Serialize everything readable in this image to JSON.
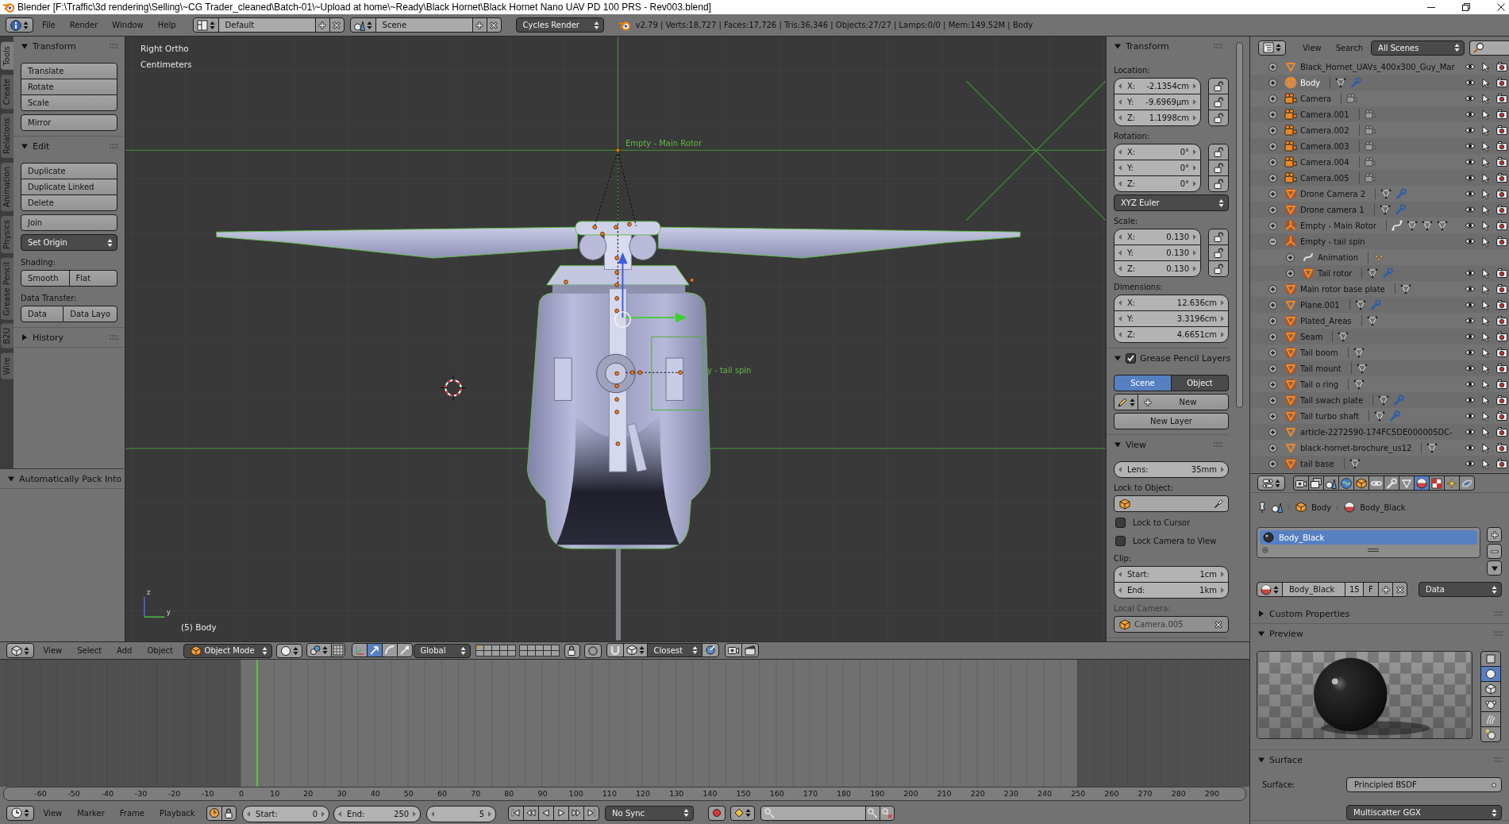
{
  "window": {
    "title": "Blender [F:\\Traffic\\3d rendering\\Selling\\~CG Trader_cleaned\\Batch-01\\~Upload at home\\~Ready\\Black Hornet\\Black Hornet Nano UAV PD 100 PRS - Rev003.blend]"
  },
  "info_header": {
    "menus": [
      "File",
      "Render",
      "Window",
      "Help"
    ],
    "screen_layout": "Default",
    "scene": "Scene",
    "render_engine": "Cycles Render",
    "stats": "v2.79 | Verts:18,727 | Faces:17,726 | Tris:36,346 | Objects:27/27 | Lamps:0/0 | Mem:149.52M | Body"
  },
  "tool_tabs": [
    {
      "label": "Tools",
      "selected": true
    },
    {
      "label": "Create",
      "selected": false
    },
    {
      "label": "Relations",
      "selected": false
    },
    {
      "label": "Animation",
      "selected": false
    },
    {
      "label": "Physics",
      "selected": false
    },
    {
      "label": "Grease Pencil",
      "selected": false
    },
    {
      "label": "B2U",
      "selected": false
    },
    {
      "label": "Wire",
      "selected": false
    }
  ],
  "tool_shelf": {
    "panels": [
      {
        "title": "Transform",
        "expanded": true,
        "rows": [
          {
            "kind": "column",
            "items": [
              "Translate",
              "Rotate",
              "Scale"
            ]
          },
          {
            "kind": "column",
            "items": [
              "Mirror"
            ]
          }
        ]
      },
      {
        "title": "Edit",
        "expanded": true,
        "rows": [
          {
            "kind": "column",
            "items": [
              "Duplicate",
              "Duplicate Linked",
              "Delete"
            ]
          },
          {
            "kind": "column",
            "items": [
              "Join"
            ]
          },
          {
            "kind": "menu",
            "label": "Set Origin"
          },
          {
            "kind": "label",
            "text": "Shading:"
          },
          {
            "kind": "row",
            "items": [
              "Smooth",
              "Flat"
            ]
          },
          {
            "kind": "label",
            "text": "Data Transfer:"
          },
          {
            "kind": "row",
            "items": [
              "Data",
              "Data Layo"
            ]
          }
        ]
      },
      {
        "title": "History",
        "expanded": false
      }
    ],
    "operator_panel": {
      "title": "Automatically Pack Into",
      "expanded": true
    }
  },
  "viewport": {
    "view_name": "Right Ortho",
    "units": "Centimeters",
    "object_info": "(5) Body",
    "object_labels": [
      "Empty - Main Rotor",
      "y - tail spin"
    ],
    "axis_labels": [
      "z",
      "y"
    ]
  },
  "properties_region": {
    "panels": [
      {
        "title": "Transform",
        "expanded": true,
        "rows": [
          {
            "kind": "label",
            "text": "Location:"
          },
          {
            "kind": "vector",
            "fields": [
              {
                "label": "X:",
                "value": "-2.1354cm",
                "locked": false
              },
              {
                "label": "Y:",
                "value": "-9.6969µm",
                "locked": false
              },
              {
                "label": "Z:",
                "value": "1.1998cm",
                "locked": false
              }
            ]
          },
          {
            "kind": "label",
            "text": "Rotation:"
          },
          {
            "kind": "vector",
            "fields": [
              {
                "label": "X:",
                "value": "0°",
                "locked": false
              },
              {
                "label": "Y:",
                "value": "0°",
                "locked": false
              },
              {
                "label": "Z:",
                "value": "0°",
                "locked": false
              }
            ]
          },
          {
            "kind": "menu",
            "label": "XYZ Euler"
          },
          {
            "kind": "label",
            "text": "Scale:"
          },
          {
            "kind": "vector",
            "fields": [
              {
                "label": "X:",
                "value": "0.130",
                "locked": false
              },
              {
                "label": "Y:",
                "value": "0.130",
                "locked": false
              },
              {
                "label": "Z:",
                "value": "0.130",
                "locked": false
              }
            ]
          },
          {
            "kind": "label",
            "text": "Dimensions:"
          },
          {
            "kind": "vector",
            "fields": [
              {
                "label": "X:",
                "value": "12.636cm"
              },
              {
                "label": "Y:",
                "value": "3.3196cm"
              },
              {
                "label": "Z:",
                "value": "4.6651cm"
              }
            ]
          }
        ]
      },
      {
        "title": "Grease Pencil Layers",
        "expanded": true,
        "checked": true,
        "rows": [
          {
            "kind": "tabs",
            "items": [
              {
                "label": "Scene",
                "selected": true
              },
              {
                "label": "Object",
                "selected": false
              }
            ]
          },
          {
            "kind": "new",
            "label": "New"
          },
          {
            "kind": "button",
            "label": "New Layer"
          }
        ]
      },
      {
        "title": "View",
        "expanded": true,
        "rows": [
          {
            "kind": "number",
            "label": "Lens:",
            "value": "35mm"
          },
          {
            "kind": "label",
            "text": "Lock to Object:"
          },
          {
            "kind": "object_field"
          },
          {
            "kind": "checkbox",
            "label": "Lock to Cursor",
            "checked": false
          },
          {
            "kind": "checkbox",
            "label": "Lock Camera to View",
            "checked": false
          },
          {
            "kind": "label",
            "text": "Clip:"
          },
          {
            "kind": "vector",
            "fields": [
              {
                "label": "Start:",
                "value": "1cm"
              },
              {
                "label": "End:",
                "value": "1km"
              }
            ]
          },
          {
            "kind": "label",
            "text": "Local Camera:",
            "disabled": true
          },
          {
            "kind": "object_field",
            "value": "Camera.005",
            "disabled": true
          }
        ]
      }
    ]
  },
  "viewport_header": {
    "menus": [
      "View",
      "Select",
      "Add",
      "Object"
    ],
    "mode": "Object Mode",
    "manipulators": [
      {
        "kind": "toggle",
        "selected": false
      },
      {
        "kind": "translate",
        "selected": true
      },
      {
        "kind": "rotate",
        "selected": false
      },
      {
        "kind": "scale",
        "selected": false
      }
    ],
    "orientation": "Global",
    "snap_target": "Closest"
  },
  "timeline": {
    "ruler": [
      "-60",
      "-50",
      "-40",
      "-30",
      "-20",
      "-10",
      "0",
      "10",
      "20",
      "30",
      "40",
      "50",
      "60",
      "70",
      "80",
      "90",
      "100",
      "110",
      "120",
      "130",
      "140",
      "150",
      "160",
      "170",
      "180",
      "190",
      "200",
      "210",
      "220",
      "230",
      "240",
      "250",
      "260",
      "270",
      "280",
      "290"
    ],
    "header": {
      "menus": [
        "View",
        "Marker",
        "Frame",
        "Playback"
      ],
      "start": {
        "label": "Start:",
        "value": "0"
      },
      "end": {
        "label": "End:",
        "value": "250"
      },
      "current_frame": "5",
      "sync": "No Sync"
    }
  },
  "outliner": {
    "menus": [
      "View",
      "Search"
    ],
    "display_mode": "All Scenes",
    "rows": [
      {
        "name": "Black_Hornet_UAVs_400x300_Guy_Mar",
        "kind": "mesh",
        "expanded": false,
        "selected": false,
        "active": false
      },
      {
        "name": "Body",
        "kind": "mesh",
        "expanded": false,
        "selected": true,
        "active": true,
        "icons": [
          {
            "kind": "mesh"
          },
          {
            "kind": "modifier"
          }
        ]
      },
      {
        "name": "Camera",
        "kind": "camera",
        "expanded": false,
        "selected": false,
        "active": false,
        "icons": [
          {
            "kind": "camera"
          }
        ]
      },
      {
        "name": "Camera.001",
        "kind": "camera",
        "expanded": false,
        "selected": false,
        "active": false,
        "icons": [
          {
            "kind": "camera"
          }
        ]
      },
      {
        "name": "Camera.002",
        "kind": "camera",
        "expanded": false,
        "selected": false,
        "active": false,
        "icons": [
          {
            "kind": "camera"
          }
        ]
      },
      {
        "name": "Camera.003",
        "kind": "camera",
        "expanded": false,
        "selected": false,
        "active": false,
        "icons": [
          {
            "kind": "camera"
          }
        ]
      },
      {
        "name": "Camera.004",
        "kind": "camera",
        "expanded": false,
        "selected": false,
        "active": false,
        "icons": [
          {
            "kind": "camera"
          }
        ]
      },
      {
        "name": "Camera.005",
        "kind": "camera",
        "expanded": false,
        "selected": false,
        "active": false,
        "icons": [
          {
            "kind": "camera"
          }
        ]
      },
      {
        "name": "Drone Camera 2",
        "kind": "mesh",
        "expanded": false,
        "selected": true,
        "active": false,
        "icons": [
          {
            "kind": "mesh"
          },
          {
            "kind": "modifier"
          }
        ]
      },
      {
        "name": "Drone camera 1",
        "kind": "mesh",
        "expanded": false,
        "selected": true,
        "active": false,
        "icons": [
          {
            "kind": "mesh"
          },
          {
            "kind": "modifier"
          }
        ]
      },
      {
        "name": "Empty - Main Rotor",
        "kind": "empty",
        "expanded": false,
        "selected": true,
        "active": false,
        "icons": [
          {
            "kind": "animation"
          },
          {
            "kind": "mesh"
          },
          {
            "kind": "mesh"
          },
          {
            "kind": "mesh"
          }
        ]
      },
      {
        "name": "Empty - tail spin",
        "kind": "empty",
        "expanded": true,
        "selected": true,
        "active": false,
        "children": [
          {
            "name": "Animation",
            "kind": "animation",
            "expanded": false,
            "selected": false,
            "active": false,
            "icons": [
              {
                "kind": "action"
              }
            ]
          },
          {
            "name": "Tail rotor",
            "kind": "mesh",
            "expanded": false,
            "selected": true,
            "active": false,
            "icons": [
              {
                "kind": "mesh"
              },
              {
                "kind": "modifier"
              }
            ]
          }
        ]
      },
      {
        "name": "Main rotor base plate",
        "kind": "mesh",
        "expanded": false,
        "selected": true,
        "active": false,
        "icons": [
          {
            "kind": "mesh"
          }
        ]
      },
      {
        "name": "Plane.001",
        "kind": "mesh",
        "expanded": false,
        "selected": false,
        "active": false,
        "icons": [
          {
            "kind": "mesh"
          },
          {
            "kind": "modifier"
          }
        ]
      },
      {
        "name": "Plated_Areas",
        "kind": "mesh",
        "expanded": false,
        "selected": true,
        "active": false,
        "icons": [
          {
            "kind": "mesh"
          }
        ]
      },
      {
        "name": "Seam",
        "kind": "mesh",
        "expanded": false,
        "selected": true,
        "active": false,
        "icons": [
          {
            "kind": "mesh"
          }
        ]
      },
      {
        "name": "Tail boom",
        "kind": "mesh",
        "expanded": false,
        "selected": true,
        "active": false,
        "icons": [
          {
            "kind": "mesh"
          }
        ]
      },
      {
        "name": "Tail mount",
        "kind": "mesh",
        "expanded": false,
        "selected": true,
        "active": false,
        "icons": [
          {
            "kind": "mesh"
          }
        ]
      },
      {
        "name": "Tail o ring",
        "kind": "mesh",
        "expanded": false,
        "selected": true,
        "active": false,
        "icons": [
          {
            "kind": "mesh"
          }
        ]
      },
      {
        "name": "Tail swach plate",
        "kind": "mesh",
        "expanded": false,
        "selected": true,
        "active": false,
        "icons": [
          {
            "kind": "mesh"
          },
          {
            "kind": "modifier"
          }
        ]
      },
      {
        "name": "Tail turbo shaft",
        "kind": "mesh",
        "expanded": false,
        "selected": true,
        "active": false,
        "icons": [
          {
            "kind": "mesh"
          },
          {
            "kind": "modifier"
          }
        ]
      },
      {
        "name": "article-2272590-174FC5DE000005DC-",
        "kind": "mesh",
        "expanded": false,
        "selected": false,
        "active": false
      },
      {
        "name": "black-hornet-brochure_us12",
        "kind": "mesh",
        "expanded": false,
        "selected": false,
        "active": false,
        "icons": [
          {
            "kind": "mesh"
          }
        ]
      },
      {
        "name": "tail base",
        "kind": "mesh",
        "expanded": false,
        "selected": true,
        "active": false,
        "icons": [
          {
            "kind": "mesh"
          }
        ]
      }
    ]
  },
  "properties": {
    "tabs": [
      {
        "kind": "render",
        "selected": false
      },
      {
        "kind": "render_layers",
        "selected": false
      },
      {
        "kind": "scene",
        "selected": false
      },
      {
        "kind": "world",
        "selected": false
      },
      {
        "kind": "object",
        "selected": false
      },
      {
        "kind": "constraints",
        "selected": false
      },
      {
        "kind": "modifiers",
        "selected": false
      },
      {
        "kind": "data",
        "selected": false
      },
      {
        "kind": "material",
        "selected": true
      },
      {
        "kind": "texture",
        "selected": false
      },
      {
        "kind": "particles",
        "selected": false
      },
      {
        "kind": "physics",
        "selected": false
      }
    ],
    "breadcrumb": [
      "Body",
      "Body_Black"
    ],
    "material_slots": [
      {
        "name": "Body_Black",
        "selected": true
      }
    ],
    "material": {
      "name": "Body_Black",
      "users": "15",
      "fake_user": "F",
      "link": "Data"
    },
    "panels": [
      {
        "kind": "custom_properties",
        "title": "Custom Properties",
        "expanded": false
      },
      {
        "kind": "preview",
        "title": "Preview",
        "expanded": true,
        "shapes": [
          {
            "kind": "plane",
            "selected": false
          },
          {
            "kind": "sphere",
            "selected": true
          },
          {
            "kind": "cube",
            "selected": false
          },
          {
            "kind": "monkey",
            "selected": false
          },
          {
            "kind": "hair",
            "selected": false
          },
          {
            "kind": "sky",
            "selected": false
          }
        ]
      },
      {
        "kind": "surface",
        "title": "Surface",
        "expanded": true,
        "label": "Surface:",
        "shader": "Principled BSDF",
        "distribution": "Multiscatter GGX"
      }
    ]
  }
}
